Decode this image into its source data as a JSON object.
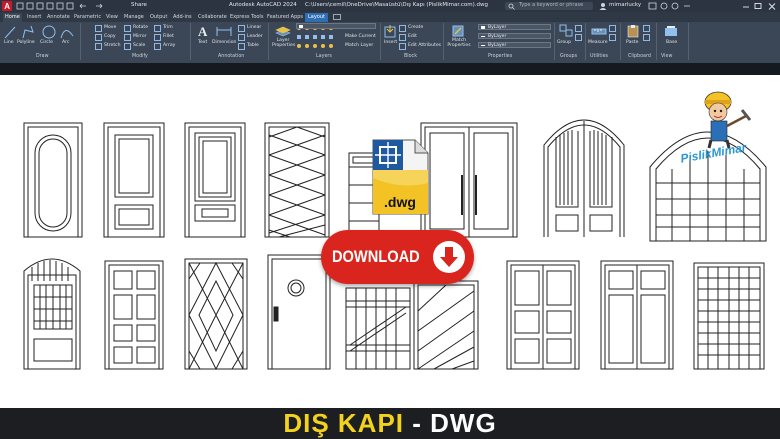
{
  "titlebar": {
    "app_title": "Autodesk AutoCAD 2024",
    "file_path": "C:\\Users\\cemil\\OneDrive\\Masaüstü\\Dış Kapı (PislikMimar.com).dwg",
    "share_label": "Share",
    "search_placeholder": "Type a keyword or phrase",
    "user_name": "mimarlucky"
  },
  "tabs": [
    "Home",
    "Insert",
    "Annotate",
    "Parametric",
    "View",
    "Manage",
    "Output",
    "Add-ins",
    "Collaborate",
    "Express Tools",
    "Featured Apps",
    "Layout"
  ],
  "ribbon": {
    "draw_tools": [
      "Line",
      "Polyline",
      "Circle",
      "Arc"
    ],
    "modify_tools": [
      "Move",
      "Rotate",
      "Trim",
      "Copy",
      "Mirror",
      "Fillet",
      "Stretch",
      "Scale",
      "Array"
    ],
    "annotation_tools": [
      "Text",
      "Dimension",
      "Linear",
      "Leader",
      "Table"
    ],
    "layer_tools": [
      "Layer Properties",
      "Make Current",
      "Match Layer"
    ],
    "block_tools": [
      "Insert",
      "Create",
      "Edit",
      "Edit Attributes"
    ],
    "properties": {
      "match_label": "Match Properties",
      "color": "ByLayer",
      "linetype": "ByLayer",
      "lineweight": "ByLayer"
    },
    "other_tools": [
      "Group",
      "Measure",
      "Paste",
      "Base"
    ],
    "panels": [
      "Draw",
      "Modify",
      "Annotation",
      "Layers",
      "Block",
      "Properties",
      "Groups",
      "Utilities",
      "Clipboard",
      "View"
    ]
  },
  "download_label": "DOWNLOAD",
  "dwg_label": ".dwg",
  "logo_text": "PislikMimar",
  "bottom_title": {
    "part1": "DIŞ KAPI",
    "dash": " - ",
    "part2": "DWG"
  },
  "colors": {
    "titlebar": "#2b3440",
    "ribbon": "#3b4756",
    "download_red": "#d9251d",
    "title_yellow": "#f2d21c",
    "logo_blue": "#2b97d4"
  }
}
